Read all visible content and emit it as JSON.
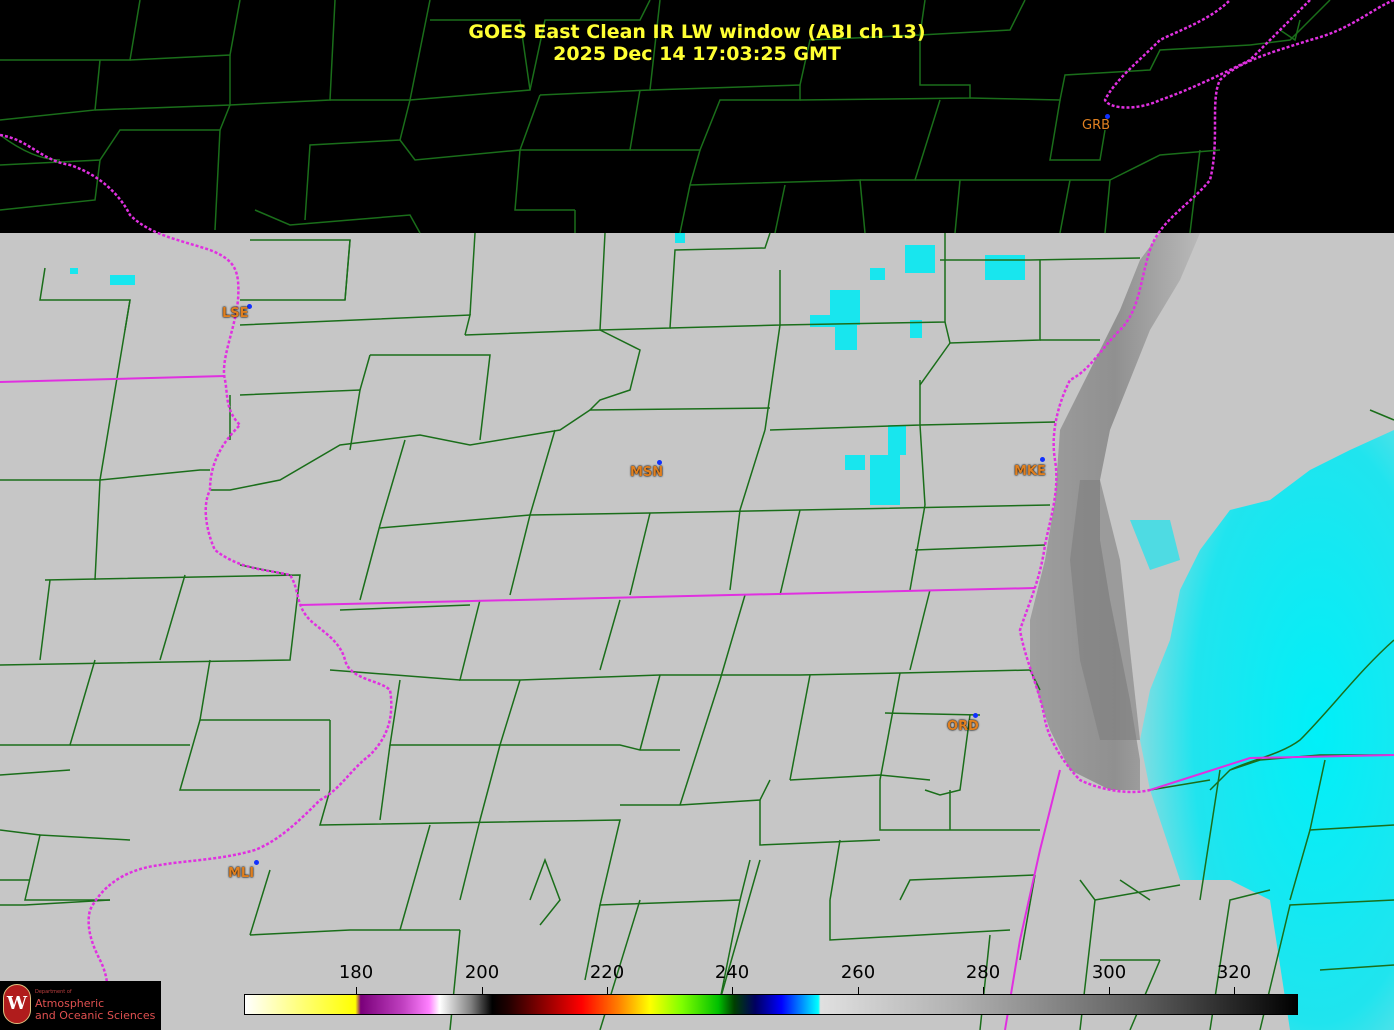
{
  "title": {
    "line1": "GOES East Clean IR LW window (ABI ch 13)",
    "line2": "2025 Dec 14  17:03:25 GMT"
  },
  "cities": [
    {
      "id": "grb",
      "label": "GRB"
    },
    {
      "id": "lse",
      "label": "LSE"
    },
    {
      "id": "msn",
      "label": "MSN"
    },
    {
      "id": "mke",
      "label": "MKE"
    },
    {
      "id": "ord",
      "label": "ORD"
    },
    {
      "id": "mli",
      "label": "MLI"
    }
  ],
  "colorbar": {
    "ticks": [
      "180",
      "200",
      "220",
      "240",
      "260",
      "280",
      "300",
      "320"
    ]
  },
  "logo": {
    "dept": "Department of",
    "line1": "Atmospheric",
    "line2": "and Oceanic Sciences"
  },
  "colors": {
    "title": "#ffff33",
    "county_lines": "#1a6e1a",
    "state_lines": "#e040e0",
    "cloud_cold": "#00e8f0",
    "ground": "#c4c4c4",
    "lake": "#8a8a8a",
    "no_data": "#000000"
  }
}
